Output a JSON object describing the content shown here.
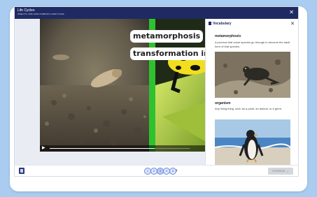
{
  "app": {
    "title": "Life Cycles",
    "subtitle": "INSECTS, FISH AND COMPLEX LIFECYCLES"
  },
  "video": {
    "captions": [
      "metamorphosis",
      "transformation in"
    ],
    "progress": 0.75,
    "play_icon": "play-icon"
  },
  "vocabulary": {
    "header": "Vocabulary",
    "close_icon": "close-icon",
    "entries": [
      {
        "term": "metamorphosis",
        "definition": "A process that some species go through to become the adult form of that species."
      },
      {
        "term": "organism",
        "definition": "Any living thing, such as a plant, an animal, or a germ."
      }
    ]
  },
  "footer": {
    "pages": [
      "1",
      "2",
      "3",
      "4",
      "5"
    ],
    "current_page_index": 2,
    "next_symbol": "›",
    "continue_label": "Continue →"
  },
  "colors": {
    "background": "#a9ccf0",
    "titlebar": "#1f2a63",
    "green_bar": "#2ec22e"
  }
}
